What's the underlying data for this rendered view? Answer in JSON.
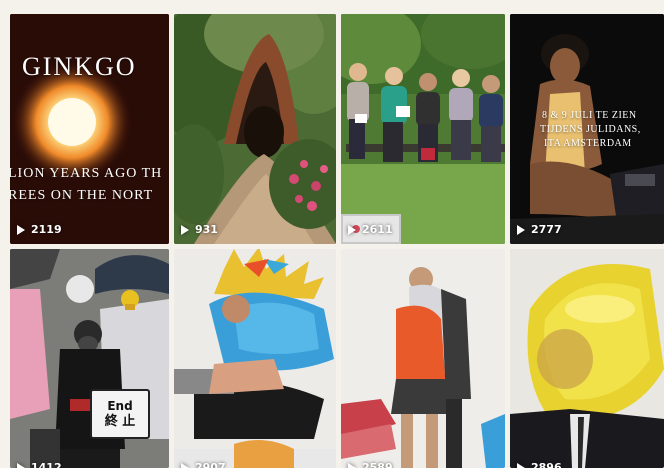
{
  "tiles": [
    {
      "views": "2119",
      "title": "GINKGO",
      "caption_1": "LION YEARS AGO TH",
      "caption_2": "REES ON THE NORT"
    },
    {
      "views": "931"
    },
    {
      "views": "2611"
    },
    {
      "views": "2777",
      "caption_1": "8 & 9 JULI TE ZIEN",
      "caption_2": "TIJDENS JULIDANS,",
      "caption_3": "ITA AMSTERDAM"
    },
    {
      "views": "1412",
      "sign_1": "End",
      "sign_2": "終 止"
    },
    {
      "views": "2907"
    },
    {
      "views": "2589"
    },
    {
      "views": "2896"
    }
  ]
}
